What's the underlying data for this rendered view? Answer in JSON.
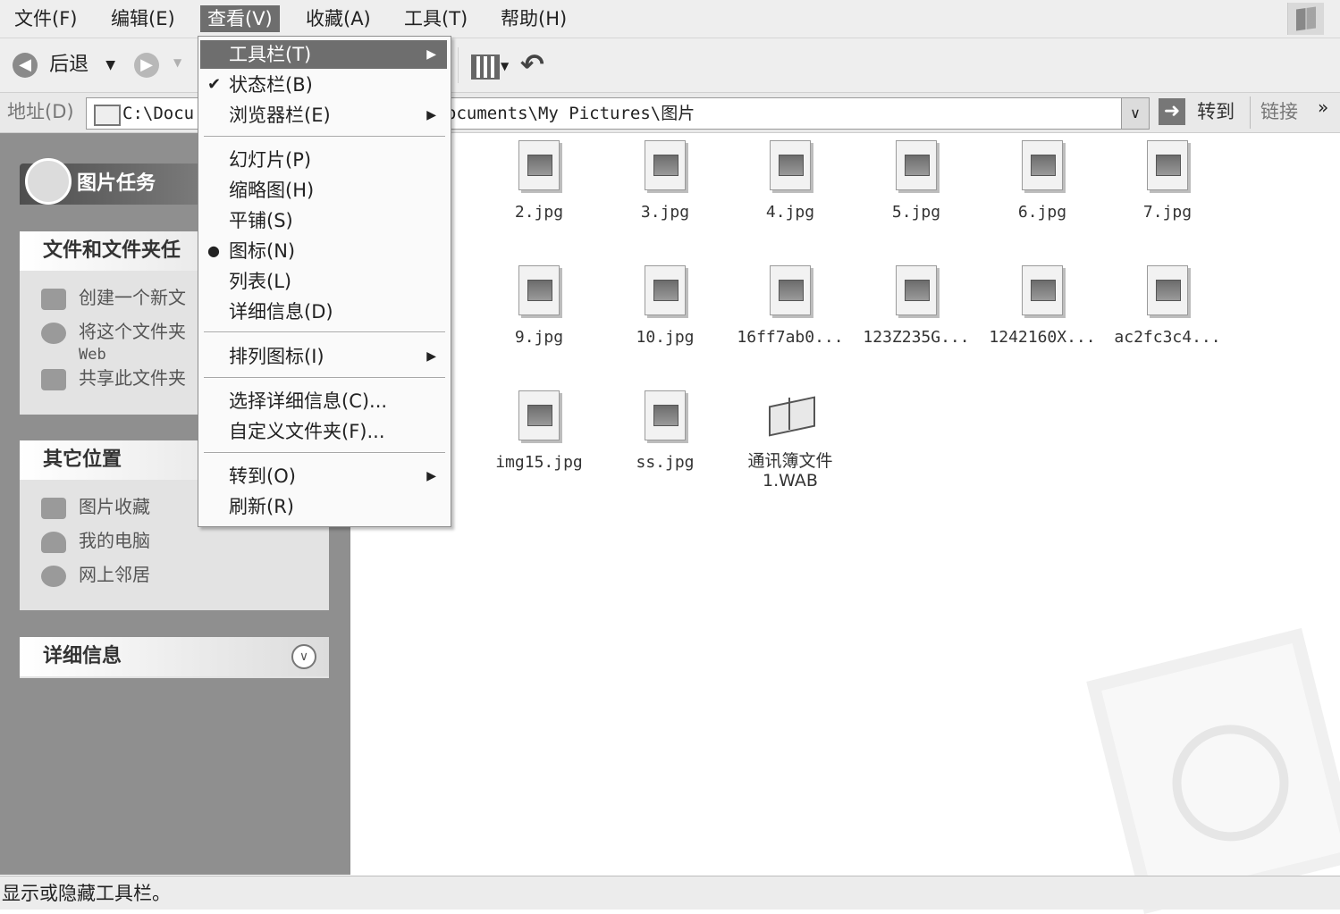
{
  "menubar": {
    "file": "文件(F)",
    "edit": "编辑(E)",
    "view": "查看(V)",
    "favorites": "收藏(A)",
    "tools": "工具(T)",
    "help": "帮助(H)"
  },
  "toolbar": {
    "back_label": "后退",
    "go_label": "转到"
  },
  "address": {
    "label": "地址(D)",
    "path_visible_left": "C:\\Docu",
    "path_visible_right": "ocuments\\My Pictures\\图片",
    "links_label": "链接"
  },
  "view_menu": {
    "toolbars": "工具栏(T)",
    "statusbar": "状态栏(B)",
    "explorer_bar": "浏览器栏(E)",
    "slideshow": "幻灯片(P)",
    "thumbnails": "缩略图(H)",
    "tiles": "平铺(S)",
    "icons": "图标(N)",
    "list": "列表(L)",
    "details": "详细信息(D)",
    "arrange_icons": "排列图标(I)",
    "choose_details": "选择详细信息(C)...",
    "customize_folder": "自定义文件夹(F)...",
    "go_to": "转到(O)",
    "refresh": "刷新(R)"
  },
  "left_pane": {
    "picture_tasks": "图片任务",
    "file_folder_tasks": "文件和文件夹任",
    "tasks": {
      "create": "创建一个新文",
      "publish": "将这个文件夹",
      "publish_web": "Web",
      "share": "共享此文件夹"
    },
    "other_places_title": "其它位置",
    "places": {
      "picture_collection": "图片收藏",
      "my_computer": "我的电脑",
      "network": "网上邻居"
    },
    "details_title": "详细信息"
  },
  "files": {
    "row1": [
      "2.jpg",
      "3.jpg",
      "4.jpg",
      "5.jpg",
      "6.jpg",
      "7.jpg"
    ],
    "row2": [
      "9.jpg",
      "10.jpg",
      "16ff7ab0...",
      "123Z235G...",
      "1242160X...",
      "ac2fc3c4..."
    ],
    "row3": [
      "img15.jpg",
      "ss.jpg",
      "通讯簿文件\n1.WAB"
    ]
  },
  "status": {
    "text": "显示或隐藏工具栏。"
  }
}
